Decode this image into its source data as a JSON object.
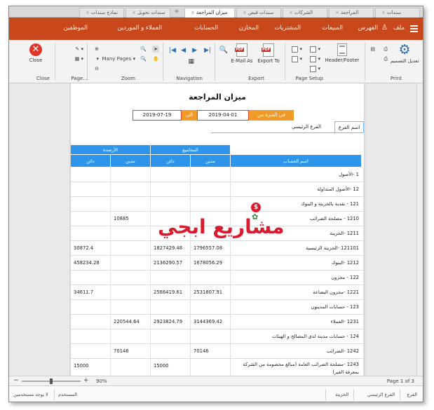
{
  "window_tabs": [
    {
      "label": "سندات",
      "x": "×"
    },
    {
      "label": "ميزان المراجعة",
      "x": "×"
    },
    {
      "label": "الشركات",
      "x": "×"
    },
    {
      "label": "سندات قبض",
      "x": "×"
    },
    {
      "label": "سندات تحويل",
      "x": "×"
    },
    {
      "label": "نماذج سندات",
      "x": "×"
    },
    {
      "label": "المراجعة",
      "x": "×"
    }
  ],
  "tab_add": "+",
  "main_menu": {
    "file": "ملف",
    "index": "الفهرس",
    "sales": "المبيعات",
    "purchases": "المشتريات",
    "stores": "المخازن",
    "accounts": "الحسابات",
    "customers": "العملاء و الموردين",
    "employees": "الموظفين"
  },
  "ribbon": {
    "print_group": "Print",
    "page_setup_group": "Page Setup",
    "export_group": "Export",
    "navigation_group": "Navigation",
    "zoom_group": "Zoom",
    "page_group": "Page...",
    "close_group": "Close",
    "edit_design": "تعديل التصميم",
    "header_footer": "Header/Footer",
    "export_to": "Export To",
    "email_as": "E-Mail As",
    "many_pages": "Many Pages",
    "close": "Close"
  },
  "report": {
    "title": "ميزان المراجعة",
    "period_label": "في الفترة من",
    "from_date": "2019-04-01",
    "to_label": "الى",
    "to_date": "2019-07-19",
    "branch_label": "اسم الفرع",
    "branch_value": "الفرع الرئيسي",
    "headers": {
      "totals": "المجاميع",
      "balance": "الأرصدة",
      "account_name": "اسم الحساب",
      "debit": "مدين",
      "credit": "دائن"
    },
    "rows": [
      {
        "name": "1 -الأصول",
        "tot_debit": "",
        "tot_credit": "",
        "bal_debit": "",
        "bal_credit": ""
      },
      {
        "name": "12 -الأصول المتداولة",
        "tot_debit": "",
        "tot_credit": "",
        "bal_debit": "",
        "bal_credit": ""
      },
      {
        "name": "121 - نقدية بالخزينة و البنوك",
        "tot_debit": "",
        "tot_credit": "",
        "bal_debit": "",
        "bal_credit": ""
      },
      {
        "name": "1210 - مصلحة الضرائب",
        "tot_debit": "",
        "tot_credit": "",
        "bal_debit": "10885",
        "bal_credit": ""
      },
      {
        "name": "1211 -الخزينة",
        "tot_debit": "",
        "tot_credit": "",
        "bal_debit": "",
        "bal_credit": ""
      },
      {
        "name": "121101 -الخزينة الرئيسية",
        "tot_debit": "1796557.08",
        "tot_credit": "1827429.48",
        "bal_debit": "",
        "bal_credit": "30872.4"
      },
      {
        "name": "1212 -البنوك",
        "tot_debit": "1678056.29",
        "tot_credit": "2136290.57",
        "bal_debit": "",
        "bal_credit": "458234.28"
      },
      {
        "name": "122 - مخزون",
        "tot_debit": "",
        "tot_credit": "",
        "bal_debit": "",
        "bal_credit": ""
      },
      {
        "name": "1221 -مخزون البضاعة",
        "tot_debit": "2531807.91",
        "tot_credit": "2566419.61",
        "bal_debit": "",
        "bal_credit": "34611.7"
      },
      {
        "name": "123 - حسابات المدينون",
        "tot_debit": "",
        "tot_credit": "",
        "bal_debit": "",
        "bal_credit": ""
      },
      {
        "name": "1231 -العملاء",
        "tot_debit": "3144369.42",
        "tot_credit": "2923824.79",
        "bal_debit": "220544.64",
        "bal_credit": ""
      },
      {
        "name": "124 - حسابات مدينة لدى المصالح و الهيئات",
        "tot_debit": "",
        "tot_credit": "",
        "bal_debit": "",
        "bal_credit": ""
      },
      {
        "name": "1242 -الضرائب",
        "tot_debit": "70146",
        "tot_credit": "",
        "bal_debit": "70146",
        "bal_credit": ""
      },
      {
        "name": "1243 -مصلحة الضرائب العامة (مبالغ مخصومة من الشركة بمعرفة الغير)",
        "tot_debit": "",
        "tot_credit": "15000",
        "bal_debit": "",
        "bal_credit": "15000"
      },
      {
        "name": "125 - حسابات مدينة لدى الموظفين",
        "tot_debit": "",
        "tot_credit": "",
        "bal_debit": "",
        "bal_credit": ""
      }
    ]
  },
  "watermark": {
    "text": "مشاريع ابجي",
    "coin": "$"
  },
  "zoom": {
    "value": "90%",
    "minus": "−",
    "plus": "+",
    "page_of": "Page 1 of 3"
  },
  "status_bar": {
    "branch_label": "الفرع",
    "branch_value": "الفرع الرئيسي",
    "treasury": "الخزينة",
    "user_label": "المستخدم",
    "no_users": "لا يوجد مستخدمين"
  },
  "colors": {
    "accent": "#c8471b",
    "table_header": "#2f95ea",
    "period": "#f29a28"
  }
}
